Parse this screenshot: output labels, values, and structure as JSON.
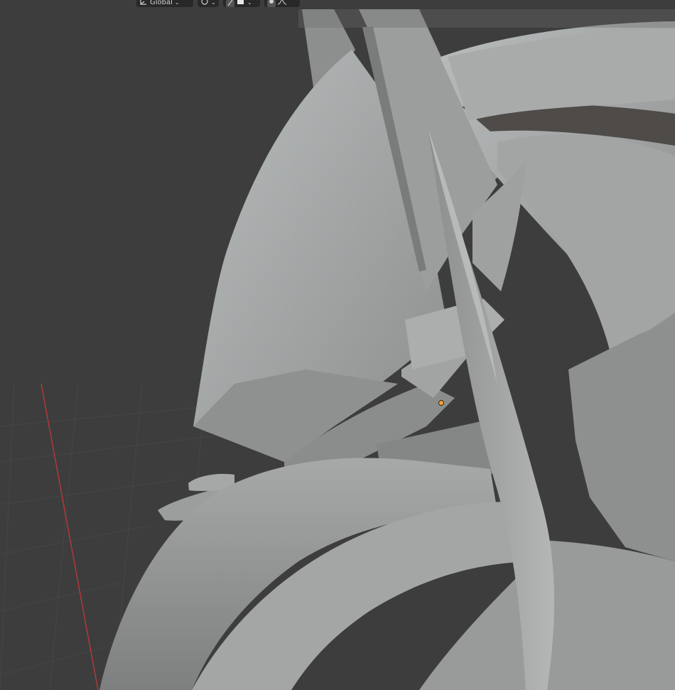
{
  "header": {
    "transform_orientation": "Global",
    "icons": {
      "orientation": "transform-orientation-icon",
      "pivot": "pivot-point-icon",
      "snap": "snap-icon",
      "snap_target": "snap-target-icon",
      "proportional": "proportional-editing-icon",
      "falloff": "falloff-curve-icon"
    }
  },
  "viewport": {
    "background": "#3d3d3d",
    "grid_color": "#474747",
    "x_axis_color": "#b03a3a",
    "origin_color": "#f4a13a",
    "mesh_color": "#9a9a9a"
  }
}
